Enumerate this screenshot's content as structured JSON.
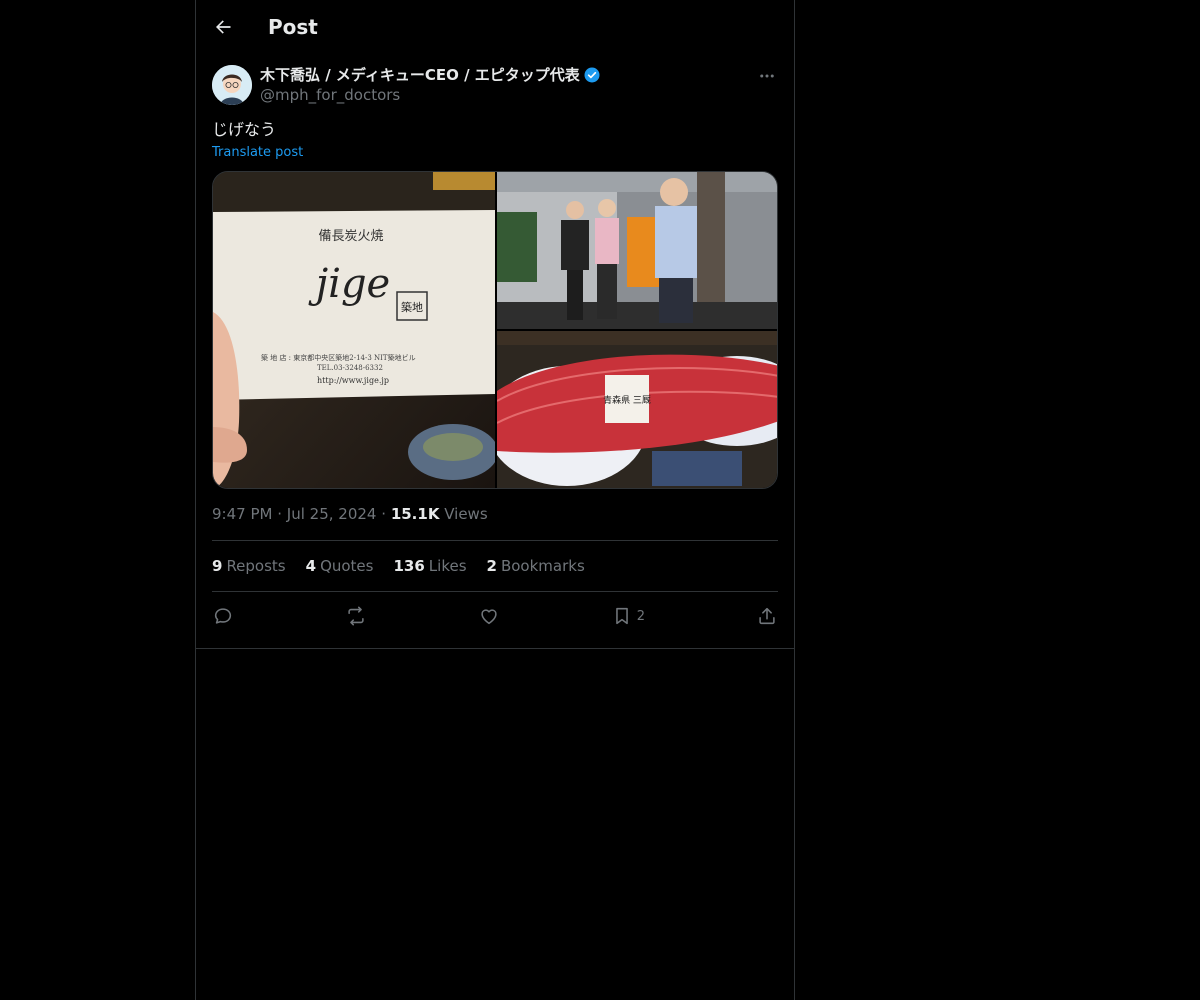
{
  "header": {
    "title": "Post"
  },
  "post": {
    "display_name": "木下喬弘 / メディキューCEO / エピタップ代表",
    "handle": "@mph_for_doctors",
    "text": "じげなう",
    "translate_label": "Translate post",
    "time": "9:47 PM",
    "date": "Jul 25, 2024",
    "views_count": "15.1K",
    "views_label": "Views",
    "separator": "·"
  },
  "media": {
    "card_line1": "備長炭火焼",
    "card_logo": "jige",
    "card_badge": "築地",
    "card_address": "築 地 店 : 東京都中央区築地2-14-3 NIT築地ビル",
    "card_tel": "TEL.03-3248-6332",
    "card_url": "http://www.jige.jp",
    "tuna_label": "青森県 三厩"
  },
  "stats": {
    "reposts": {
      "count": "9",
      "label": "Reposts"
    },
    "quotes": {
      "count": "4",
      "label": "Quotes"
    },
    "likes": {
      "count": "136",
      "label": "Likes"
    },
    "bookmarks": {
      "count": "2",
      "label": "Bookmarks"
    }
  },
  "actions": {
    "bookmark_count": "2"
  },
  "icons": [
    "back-arrow-icon",
    "verified-badge-icon",
    "more-icon",
    "reply-icon",
    "repost-icon",
    "like-icon",
    "bookmark-icon",
    "share-icon"
  ],
  "colors": {
    "background": "#000000",
    "text": "#e7e9ea",
    "muted": "#71767b",
    "accent": "#1d9bf0",
    "border": "#2f3336"
  }
}
